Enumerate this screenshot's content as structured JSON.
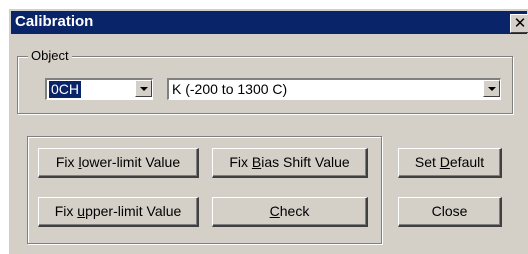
{
  "window": {
    "title": "Calibration",
    "close_label": "✕"
  },
  "object_group": {
    "label": "Object",
    "channel_select": {
      "value": "0CH"
    },
    "sensor_select": {
      "value": "K (-200 to 1300 C)"
    }
  },
  "buttons": {
    "fix_lower": {
      "pre": "Fix ",
      "key": "l",
      "post": "ower-limit Value"
    },
    "fix_bias": {
      "pre": "Fix ",
      "key": "B",
      "post": "ias Shift Value"
    },
    "fix_upper": {
      "pre": "Fix ",
      "key": "u",
      "post": "pper-limit Value"
    },
    "check": {
      "pre": "",
      "key": "C",
      "post": "heck"
    },
    "set_default": {
      "pre": "Set ",
      "key": "D",
      "post": "efault"
    },
    "close": {
      "pre": "",
      "key": "",
      "post": "Close"
    }
  }
}
